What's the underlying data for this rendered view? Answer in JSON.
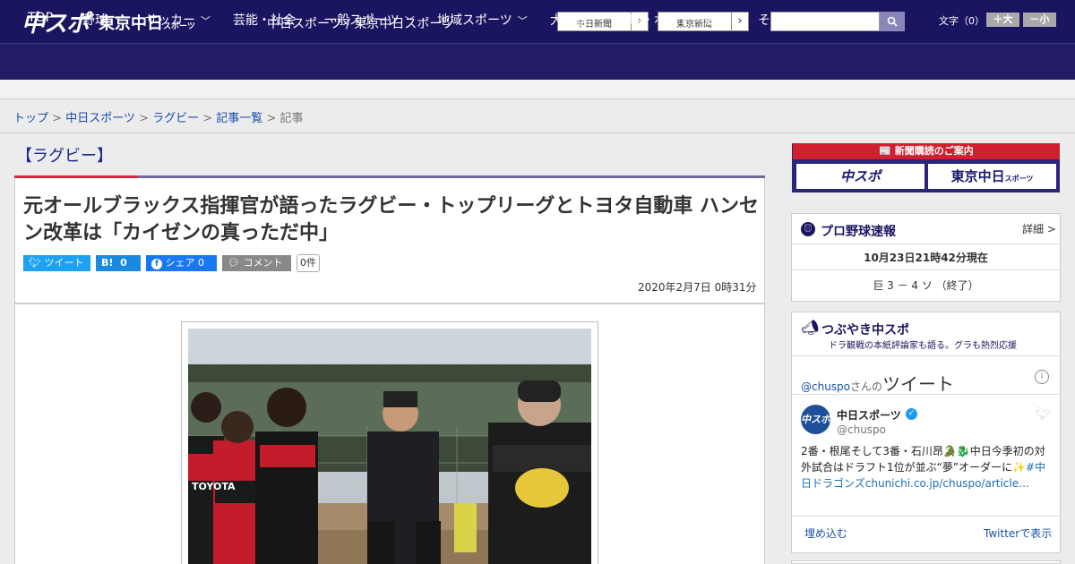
{
  "header": {
    "logo_chuspo": "中スポ",
    "logo_tokyo": "東京中日",
    "logo_tokyo_small": "スポーツ",
    "site_text": "中日スポーツ / 東京中日スポーツ",
    "paper1": "中日新聞",
    "paper2": "東京新聞",
    "arrow": "›",
    "search_placeholder": "",
    "search_icon": "search-icon",
    "font_size_label": "文字（0）",
    "font_larger": "＋大",
    "font_smaller": "－小"
  },
  "nav": [
    {
      "label": "TOP",
      "chev": ""
    },
    {
      "label": "野球",
      "chev": "﹀"
    },
    {
      "label": "サッカー",
      "chev": "﹀"
    },
    {
      "label": "芸能・社会",
      "chev": ""
    },
    {
      "label": "一般スポーツ",
      "chev": "﹀"
    },
    {
      "label": "地域スポーツ",
      "chev": "﹀"
    },
    {
      "label": "大相撲",
      "chev": ""
    },
    {
      "label": "競馬・ボート・競輪",
      "chev": ""
    },
    {
      "label": "その他",
      "chev": "﹀"
    }
  ],
  "breadcrumb": {
    "items": [
      "トップ",
      "中日スポーツ",
      "ラグビー",
      "記事一覧"
    ],
    "sep": " > ",
    "current": "記事"
  },
  "article": {
    "section": "【ラグビー】",
    "headline": "元オールブラックス指揮官が語ったラグビー・トップリーグとトヨタ自動車 ハンセン改革は「カイゼンの真っただ中」",
    "date": "2020年2月7日 0時31分",
    "share": {
      "tweet": "ツイート",
      "hatena": "B!",
      "hatena_count": "0",
      "facebook": "シェア",
      "facebook_count": "0",
      "comment": "コメント",
      "comment_count": "0件"
    },
    "photo_text": {
      "jersey_team": "TOYOTA"
    }
  },
  "sidebar": {
    "subscription": {
      "title": "新聞購読のご案内",
      "btn1": "中スポ",
      "btn2": "東京中日",
      "btn2_small": "スポーツ"
    },
    "baseball": {
      "title": "プロ野球速報",
      "detail": "詳細 >",
      "time": "10月23日21時42分現在",
      "score": "巨 3 － 4 ソ （終了）"
    },
    "tweets": {
      "title": "つぶやき中スポ",
      "subtitle": "ドラ観戦の本紙評論家も語る。グラも熱烈応援",
      "user_handle": "@chuspo",
      "san": "さんの",
      "tweet_word": "ツイート",
      "account_name": "中日スポーツ",
      "account_handle": "@chuspo",
      "avatar_text": "中スポ",
      "text_part1": "2番・根尾そして3番・石川昂🐊🐉中日今季初の対外試合はドラフト1位が並ぶ“夢”オーダーに✨",
      "hashtag": "#中日ドラゴンズ",
      "link": "chunichi.co.jp/chuspo/article…",
      "embed": "埋め込む",
      "view_on_twitter": "Twitterで表示"
    }
  },
  "colors": {
    "header_bg": "#1a1560",
    "nav_bg": "#221b66",
    "accent_red": "#d32b3d",
    "accent_purple": "#726a9e",
    "link": "#1a4faa",
    "twitter_btn": "#1da1f2",
    "hatena_btn": "#1a8ae0",
    "facebook_btn": "#1877f2",
    "comment_btn": "#888888"
  }
}
